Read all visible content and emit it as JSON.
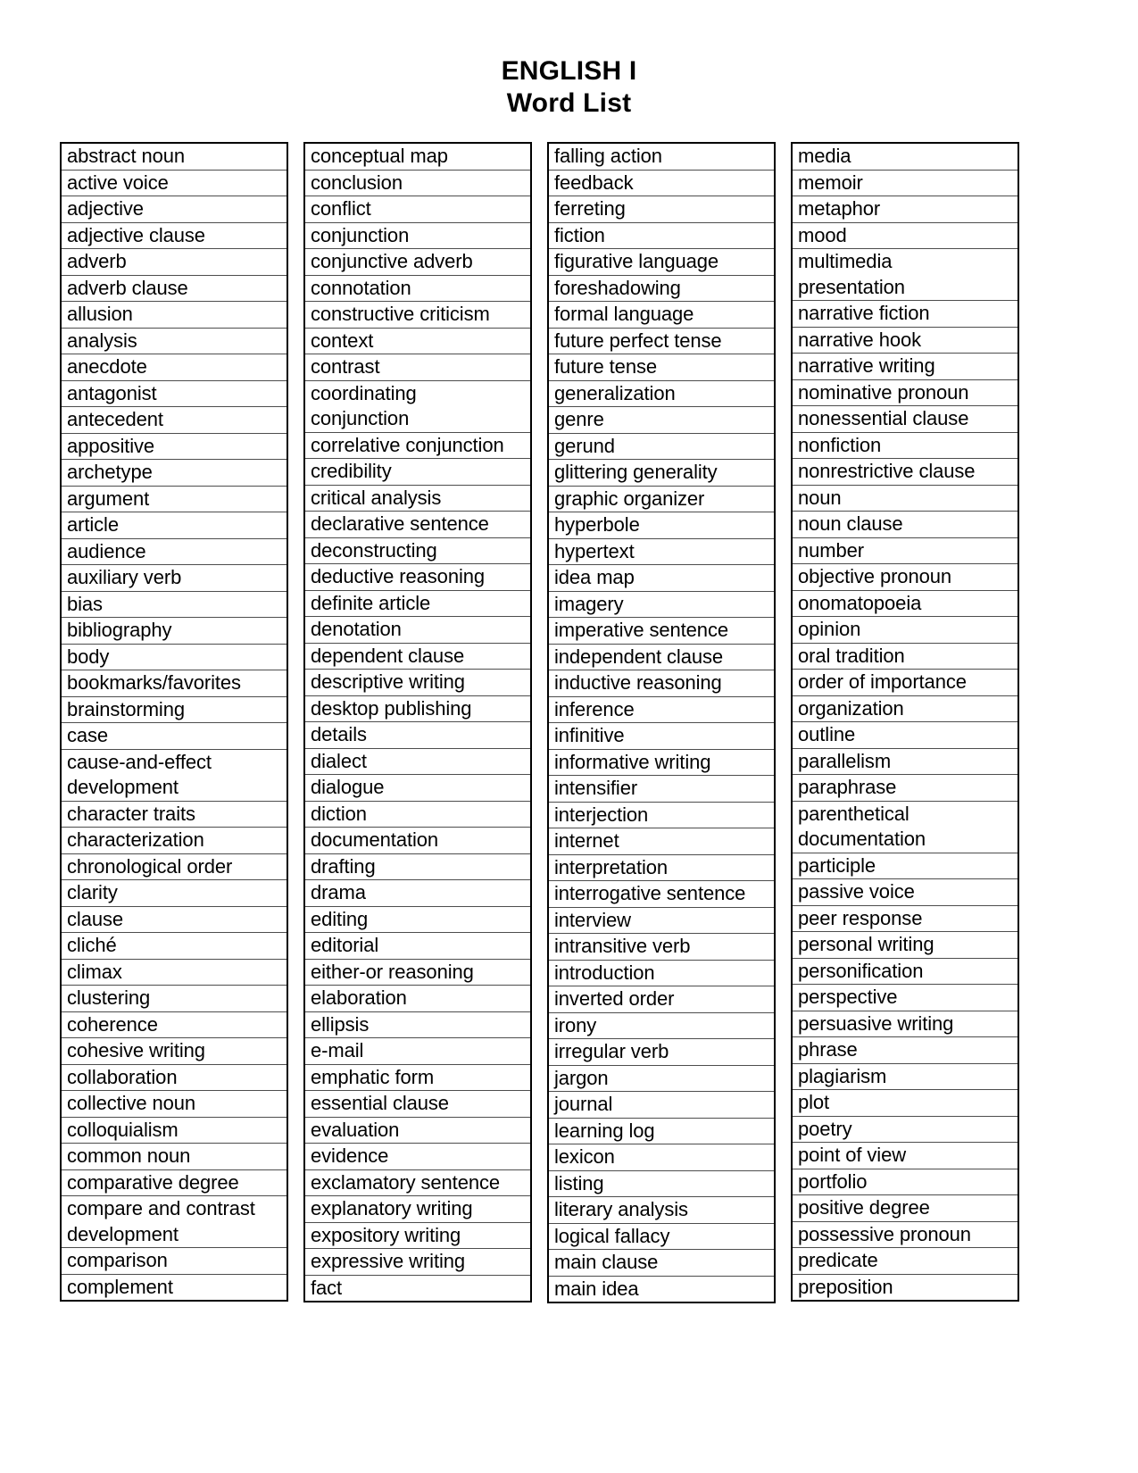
{
  "document": {
    "title_line_1": "ENGLISH I",
    "title_line_2": "Word List"
  },
  "columns": [
    {
      "id": "column-1",
      "words": [
        "abstract noun",
        "active voice",
        "adjective",
        "adjective clause",
        "adverb",
        "adverb clause",
        "allusion",
        "analysis",
        "anecdote",
        "antagonist",
        "antecedent",
        "appositive",
        "archetype",
        "argument",
        "article",
        "audience",
        "auxiliary verb",
        "bias",
        "bibliography",
        "body",
        "bookmarks/favorites",
        "brainstorming",
        "case",
        "cause-and-effect\ndevelopment",
        "character traits",
        "characterization",
        "chronological order",
        "clarity",
        "clause",
        "cliché",
        "climax",
        "clustering",
        "coherence",
        "cohesive writing",
        "collaboration",
        "collective noun",
        "colloquialism",
        "common noun",
        "comparative degree",
        "compare and contrast\ndevelopment",
        "comparison",
        "complement"
      ]
    },
    {
      "id": "column-2",
      "words": [
        "conceptual map",
        "conclusion",
        "conflict",
        "conjunction",
        "conjunctive adverb",
        "connotation",
        "constructive criticism",
        "context",
        "contrast",
        "coordinating\nconjunction",
        "correlative conjunction",
        "credibility",
        "critical analysis",
        "declarative sentence",
        "deconstructing",
        "deductive reasoning",
        "definite article",
        "denotation",
        "dependent clause",
        "descriptive writing",
        "desktop publishing",
        "details",
        "dialect",
        "dialogue",
        "diction",
        "documentation",
        "drafting",
        "drama",
        "editing",
        "editorial",
        "either-or reasoning",
        "elaboration",
        "ellipsis",
        "e-mail",
        "emphatic form",
        "essential clause",
        "evaluation",
        "evidence",
        "exclamatory sentence",
        "explanatory writing",
        "expository writing",
        "expressive writing",
        "fact"
      ]
    },
    {
      "id": "column-3",
      "words": [
        "falling action",
        "feedback",
        "ferreting",
        "fiction",
        "figurative language",
        "foreshadowing",
        "formal language",
        "future perfect tense",
        "future tense",
        "generalization",
        "genre",
        "gerund",
        "glittering generality",
        "graphic organizer",
        "hyperbole",
        "hypertext",
        "idea map",
        "imagery",
        "imperative sentence",
        "independent clause",
        "inductive reasoning",
        "inference",
        "infinitive",
        "informative writing",
        "intensifier",
        "interjection",
        "internet",
        "interpretation",
        "interrogative sentence",
        "interview",
        "intransitive verb",
        "introduction",
        "inverted order",
        "irony",
        "irregular verb",
        "jargon",
        "journal",
        "learning log",
        "lexicon",
        "listing",
        "literary analysis",
        "logical fallacy",
        "main clause",
        "main idea"
      ]
    },
    {
      "id": "column-4",
      "words": [
        "media",
        "memoir",
        "metaphor",
        "mood",
        "multimedia\npresentation",
        "narrative fiction",
        "narrative hook",
        "narrative writing",
        "nominative pronoun",
        "nonessential clause",
        "nonfiction",
        "nonrestrictive clause",
        "noun",
        "noun clause",
        "number",
        "objective pronoun",
        "onomatopoeia",
        "opinion",
        "oral tradition",
        "order of importance",
        "organization",
        "outline",
        "parallelism",
        "paraphrase",
        "parenthetical\ndocumentation",
        "participle",
        "passive voice",
        "peer response",
        "personal writing",
        "personification",
        "perspective",
        "persuasive writing",
        "phrase",
        "plagiarism",
        "plot",
        "poetry",
        "point of view",
        "portfolio",
        "positive degree",
        "possessive pronoun",
        "predicate",
        "preposition"
      ]
    }
  ]
}
